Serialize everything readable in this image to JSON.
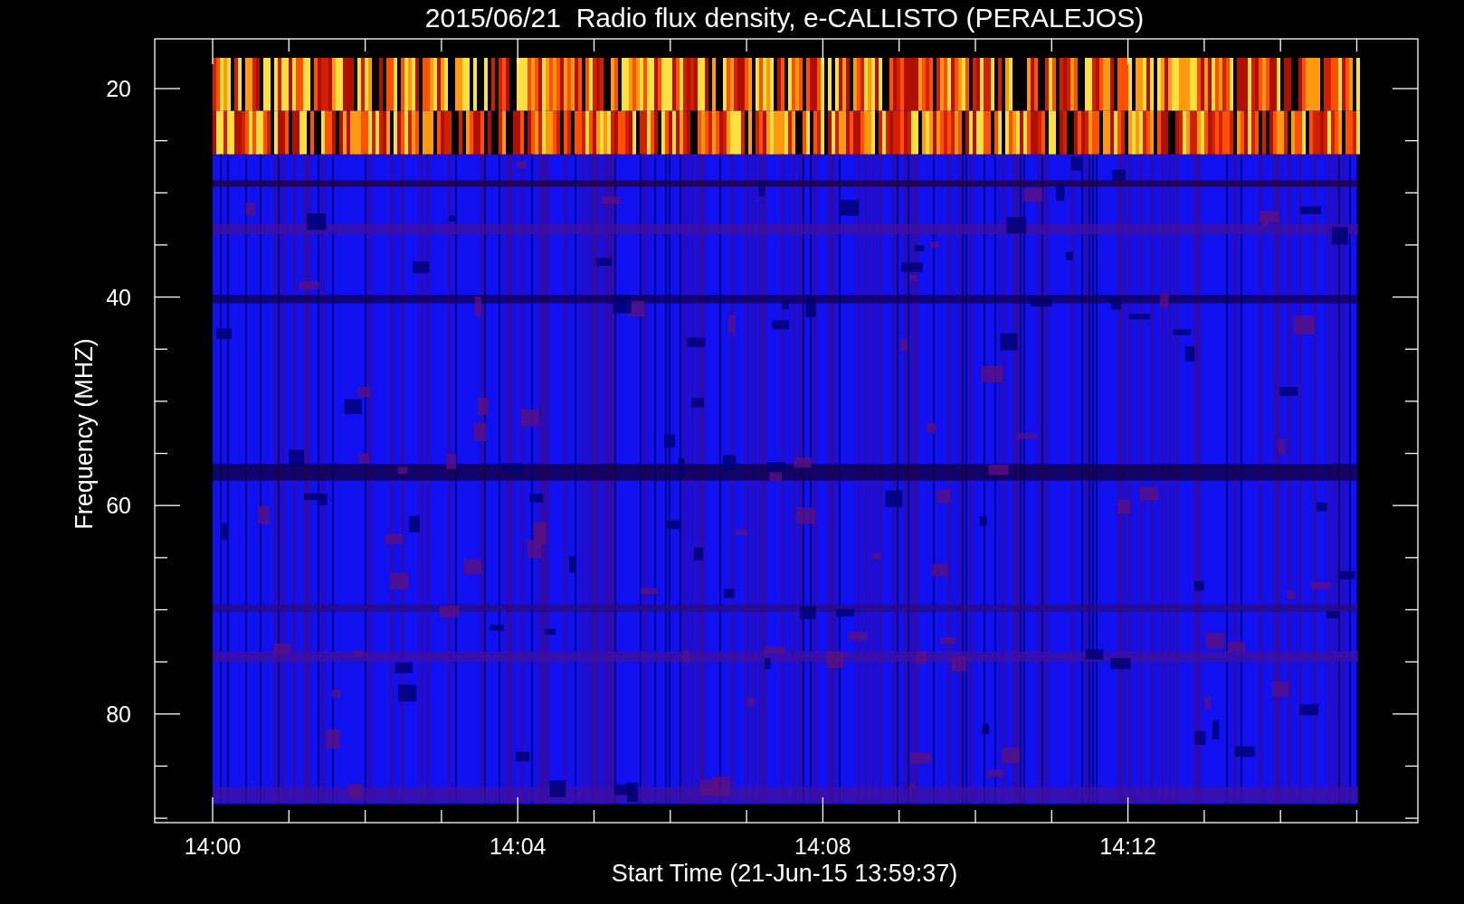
{
  "plot": {
    "title": "2015/06/21  Radio flux density, e-CALLISTO (PERALEJOS)",
    "ylabel": "Frequency (MHZ)",
    "xlabel": "Start Time (21-Jun-15 13:59:37)",
    "yticks": [
      "20",
      "40",
      "60",
      "80"
    ],
    "xticks": [
      "14:00",
      "14:04",
      "14:08",
      "14:12"
    ]
  }
}
